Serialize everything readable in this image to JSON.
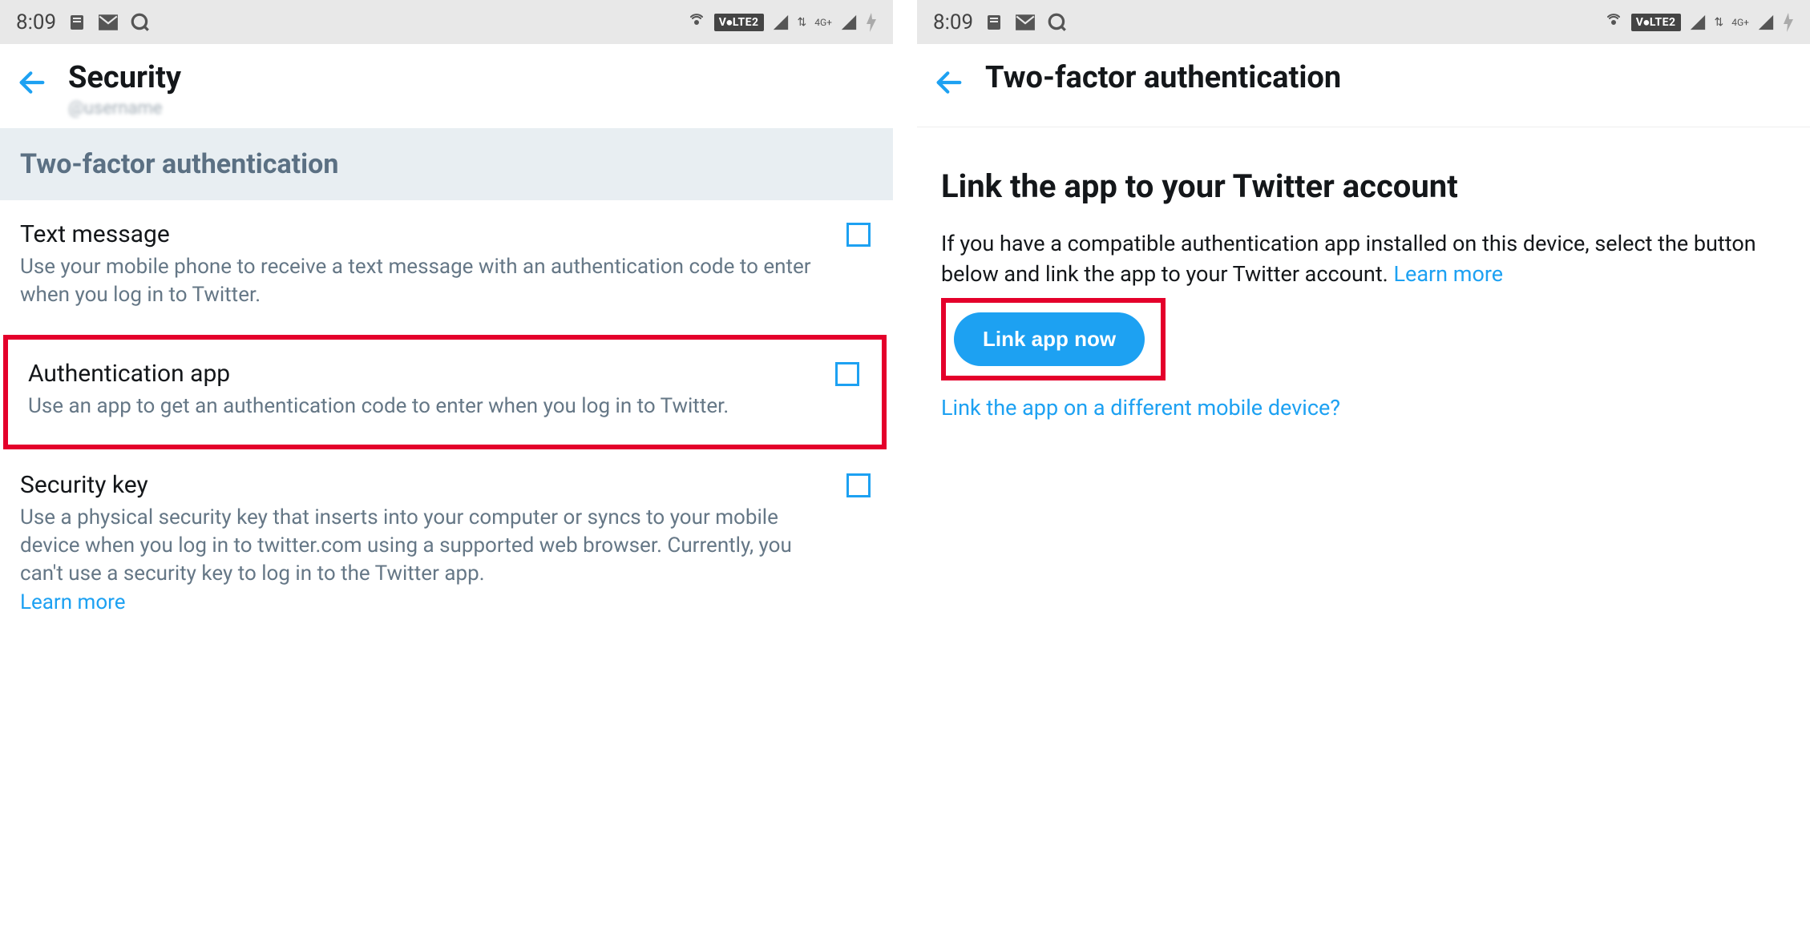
{
  "status": {
    "time": "8:09",
    "volte": "V⦁LTE2",
    "network_label": "4G+"
  },
  "left": {
    "header_title": "Security",
    "section_header": "Two-factor authentication",
    "options": {
      "text_message": {
        "title": "Text message",
        "desc": "Use your mobile phone to receive a text message with an authentication code to enter when you log in to Twitter."
      },
      "auth_app": {
        "title": "Authentication app",
        "desc": "Use an app to get an authentication code to enter when you log in to Twitter."
      },
      "security_key": {
        "title": "Security key",
        "desc": "Use a physical security key that inserts into your computer or syncs to your mobile device when you log in to twitter.com using a supported web browser. Currently, you can't use a security key to log in to the Twitter app.",
        "learn_more": "Learn more"
      }
    }
  },
  "right": {
    "header_title": "Two-factor authentication",
    "heading": "Link the app to your Twitter account",
    "body": "If you have a compatible authentication app installed on this device, select the button below and link the app to your Twitter account. ",
    "learn_more": "Learn more",
    "button_label": "Link app now",
    "alt_link": "Link the app on a different mobile device?"
  }
}
